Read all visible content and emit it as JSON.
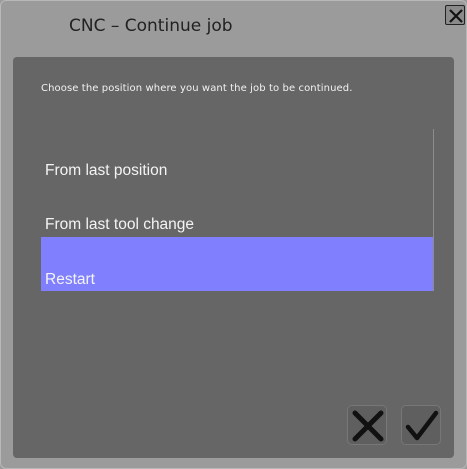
{
  "window": {
    "title": "CNC – Continue job",
    "close_icon": "close-icon"
  },
  "prompt": {
    "instruction": "Choose the position where you want the job to be continued."
  },
  "options": [
    {
      "label": "From last position",
      "selected": false
    },
    {
      "label": "From last tool change",
      "selected": false
    },
    {
      "label": "Restart",
      "selected": true
    }
  ],
  "buttons": {
    "cancel_icon": "cancel-x-icon",
    "ok_icon": "checkmark-icon"
  },
  "colors": {
    "selection": "#8080ff",
    "panel": "#666666",
    "window": "#9b9b9b"
  }
}
